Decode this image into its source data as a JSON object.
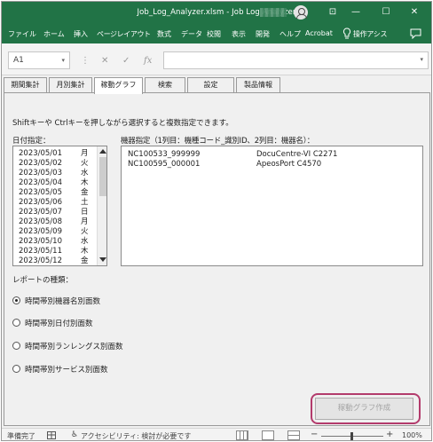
{
  "window": {
    "title": "Job_Log_Analyzer.xlsm  -  Job Log Analyzer",
    "controls": {
      "ribbon_display": "⊡",
      "minimize": "—",
      "maximize": "☐",
      "close": "✕"
    }
  },
  "ribbon": {
    "tabs": [
      "ファイル",
      "ホーム",
      "挿入",
      "ページレイアウト",
      "数式",
      "データ",
      "校閲",
      "表示",
      "開発",
      "ヘルプ",
      "Acrobat"
    ],
    "tell_me": "操作アシス"
  },
  "formula_bar": {
    "name_box": "A1",
    "icons": [
      "⋮",
      "✕",
      "✓",
      "fx"
    ]
  },
  "sheet_tabs": [
    "期間集計",
    "月別集計",
    "稼動グラフ",
    "検索",
    "設定",
    "製品情報"
  ],
  "form": {
    "instruction": "Shiftキーや Ctrlキーを押しながら選択すると複数指定できます。",
    "date_label": "日付指定：",
    "dates": [
      {
        "date": "2023/05/01",
        "day": "月"
      },
      {
        "date": "2023/05/02",
        "day": "火"
      },
      {
        "date": "2023/05/03",
        "day": "水"
      },
      {
        "date": "2023/05/04",
        "day": "木"
      },
      {
        "date": "2023/05/05",
        "day": "金"
      },
      {
        "date": "2023/05/06",
        "day": "土"
      },
      {
        "date": "2023/05/07",
        "day": "日"
      },
      {
        "date": "2023/05/08",
        "day": "月"
      },
      {
        "date": "2023/05/09",
        "day": "火"
      },
      {
        "date": "2023/05/10",
        "day": "水"
      },
      {
        "date": "2023/05/11",
        "day": "木"
      },
      {
        "date": "2023/05/12",
        "day": "金"
      }
    ],
    "device_label": "機器指定（1列目：機種コード_識別ID、2列目：機器名）：",
    "devices": [
      {
        "id": "NC100533_999999",
        "name": "DocuCentre-VI C2271"
      },
      {
        "id": "NC100595_000001",
        "name": "ApeosPort C4570"
      }
    ],
    "report_label": "レポートの種類：",
    "report_options": [
      "時間帯別機器名別面数",
      "時間帯別日付別面数",
      "時間帯別ランレングス別面数",
      "時間帯別サービス別面数"
    ],
    "report_selected": 0,
    "create_button": "稼動グラフ作成"
  },
  "status_bar": {
    "ready": "準備完了",
    "accessibility": "アクセシビリティ: 検討が必要です",
    "zoom": "100%"
  }
}
